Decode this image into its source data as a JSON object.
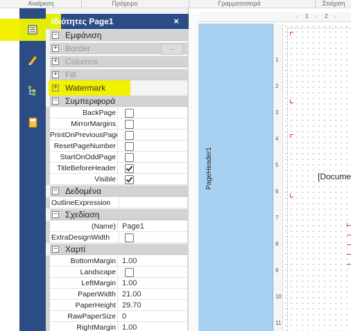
{
  "ribbon": {
    "groups": [
      "Αναίρεση",
      "Πρόχειρο",
      "Γραμματοσειρά",
      "Στοίχιση"
    ]
  },
  "sidebar": {
    "icons": [
      "properties-icon",
      "style-designer-icon",
      "report-tree-icon",
      "dictionary-icon"
    ]
  },
  "properties": {
    "title": "Ιδιότητες Page1",
    "close_glyph": "×",
    "categories": {
      "appearance": "Εμφάνιση",
      "border": "Border",
      "border_btn": "...",
      "columns": "Columns",
      "fill": "Fill",
      "watermark": "Watermark",
      "behavior": "Συμπεριφορά",
      "data": "Δεδομένα",
      "design": "Σχεδίαση",
      "paper": "Χαρτί"
    },
    "behavior": [
      {
        "name": "BackPage",
        "checked": false
      },
      {
        "name": "MirrorMargins",
        "checked": false
      },
      {
        "name": "PrintOnPreviousPage",
        "checked": false
      },
      {
        "name": "ResetPageNumber",
        "checked": false
      },
      {
        "name": "StartOnOddPage",
        "checked": false
      },
      {
        "name": "TitleBeforeHeader",
        "checked": true
      },
      {
        "name": "Visible",
        "checked": true
      }
    ],
    "data_props": [
      {
        "name": "OutlineExpression",
        "value": ""
      }
    ],
    "design_props": [
      {
        "name": "(Name)",
        "value": "Page1"
      },
      {
        "name": "ExtraDesignWidth",
        "checked": false
      }
    ],
    "paper_props": [
      {
        "name": "BottomMargin",
        "value": "1.00"
      },
      {
        "name": "Landscape",
        "checked": false
      },
      {
        "name": "LeftMargin",
        "value": "1.00"
      },
      {
        "name": "PaperWidth",
        "value": "21.00"
      },
      {
        "name": "PaperHeight",
        "value": "29.70"
      },
      {
        "name": "RawPaperSize",
        "value": "0"
      },
      {
        "name": "RightMargin",
        "value": "1.00"
      }
    ]
  },
  "designer": {
    "band_label": "PageHeader1",
    "document_text": "[Docume",
    "hruler_ticks": [
      "·",
      "1",
      "·",
      "2",
      "·"
    ],
    "vruler_ticks": [
      "1",
      "2",
      "3",
      "4",
      "5",
      "6",
      "7",
      "8",
      "9",
      "10",
      "11"
    ]
  },
  "colors": {
    "panel_header": "#2c4c86",
    "highlight": "#f2f200",
    "band": "#a8d0f0"
  }
}
